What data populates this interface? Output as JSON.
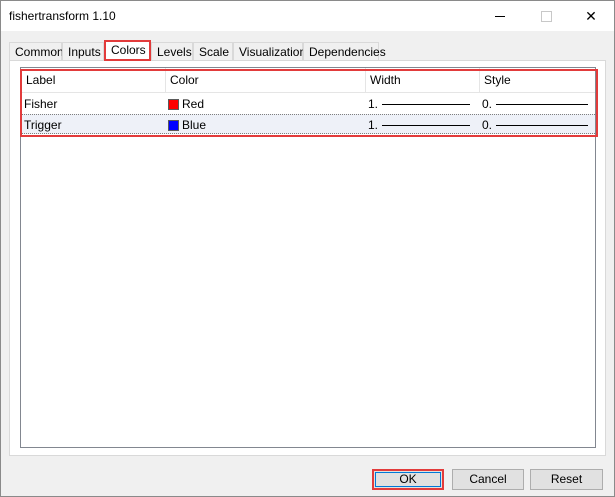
{
  "window": {
    "title": "fishertransform 1.10",
    "close_glyph": "✕"
  },
  "tabs": [
    {
      "label": "Common"
    },
    {
      "label": "Inputs"
    },
    {
      "label": "Colors",
      "active": true
    },
    {
      "label": "Levels"
    },
    {
      "label": "Scale"
    },
    {
      "label": "Visualization"
    },
    {
      "label": "Dependencies"
    }
  ],
  "table": {
    "headers": {
      "label": "Label",
      "color": "Color",
      "width": "Width",
      "style": "Style"
    },
    "rows": [
      {
        "label": "Fisher",
        "color_name": "Red",
        "color_hex": "#ff0000",
        "width": "1.",
        "style": "0."
      },
      {
        "label": "Trigger",
        "color_name": "Blue",
        "color_hex": "#0000ff",
        "width": "1.",
        "style": "0."
      }
    ]
  },
  "buttons": {
    "ok": "OK",
    "cancel": "Cancel",
    "reset": "Reset"
  },
  "colors": {
    "highlight": "#e23b3b",
    "selected_row": "#eef1f8"
  }
}
